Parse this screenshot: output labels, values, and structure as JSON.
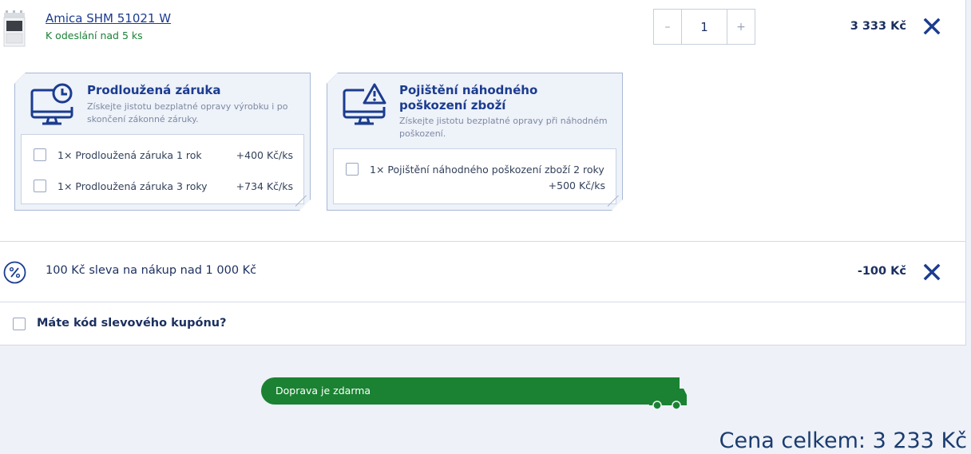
{
  "product": {
    "name": "Amica SHM 51021 W",
    "stock": "K odeslání nad 5 ks",
    "quantity": "1",
    "qty_minus": "–",
    "qty_plus": "+",
    "price": "3 333 Kč"
  },
  "services": [
    {
      "title": "Prodloužená záruka",
      "desc": "Získejte jistotu bezplatné opravy výrobku i po skončení zákonné záruky.",
      "icon": "monitor-clock-icon",
      "options": [
        {
          "label": "1× Prodloužená záruka 1 rok",
          "price": "+400 Kč/ks"
        },
        {
          "label": "1× Prodloužená záruka 3 roky",
          "price": "+734 Kč/ks"
        }
      ]
    },
    {
      "title": "Pojištění náhodného poškození zboží",
      "desc": "Získejte jistotu bezplatné opravy při náhodném poškození.",
      "icon": "monitor-warning-icon",
      "options": [
        {
          "label": "1× Pojištění náhodného poškození zboží 2 roky",
          "price": "+500 Kč/ks"
        }
      ]
    }
  ],
  "discount": {
    "label": "100 Kč sleva na nákup nad 1 000 Kč",
    "value": "-100 Kč",
    "icon": "percent-icon"
  },
  "coupon": {
    "label": "Máte kód slevového kupónu?"
  },
  "shipping": {
    "label": "Doprava je zdarma",
    "progress": 1.0,
    "icon": "truck-icon"
  },
  "total": {
    "label": "Cena celkem: 3 233 Kč"
  },
  "colors": {
    "brand": "#1b3c8f",
    "success": "#1a8232",
    "text": "#1b2f5f"
  }
}
